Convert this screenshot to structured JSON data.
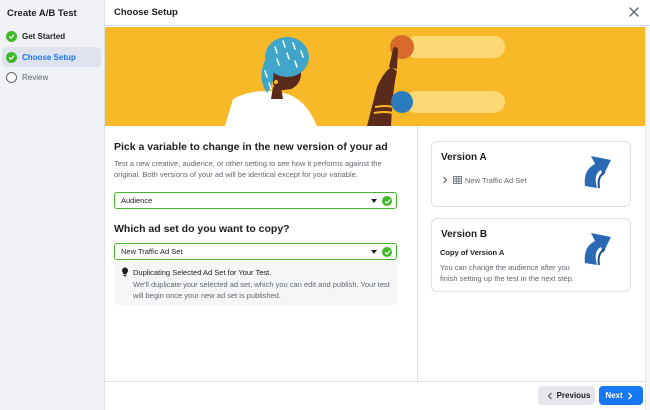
{
  "sidebar": {
    "title": "Create A/B Test",
    "steps": [
      {
        "label": "Get Started",
        "state": "done"
      },
      {
        "label": "Choose Setup",
        "state": "active"
      },
      {
        "label": "Review",
        "state": "pending"
      }
    ]
  },
  "header": {
    "title": "Choose Setup"
  },
  "main": {
    "variable_title": "Pick a variable to change in the new version of your ad",
    "variable_desc": "Test a new creative, audience, or other setting to see how it performs against the original. Both versions of your ad will be identical except for your variable.",
    "variable_select": "Audience",
    "copy_title": "Which ad set do you want to copy?",
    "copy_select": "New Traffic Ad Set",
    "notice_title": "Duplicating Selected Ad Set for Your Test.",
    "notice_body": "We'll duplicate your selected ad set, which you can edit and publish. Your test will begin once your new ad set is published."
  },
  "versions": {
    "a": {
      "title": "Version A",
      "adset": "New Traffic Ad Set"
    },
    "b": {
      "title": "Version B",
      "subtitle": "Copy of Version A",
      "desc": "You can change the audience after you finish setting up the test in the next step."
    }
  },
  "footer": {
    "previous": "Previous",
    "next": "Next"
  },
  "icons": {
    "step_done": "check-circle-icon",
    "step_pending": "empty-circle-icon",
    "close": "close-icon",
    "select_valid": "check-circle-icon",
    "notice": "lightbulb-icon",
    "version_arrow": "curved-arrow-icon",
    "expand": "chevron-right-icon",
    "adset": "grid-icon",
    "previous": "chevron-left-icon",
    "next": "chevron-right-icon"
  },
  "colors": {
    "accent": "#1877f2",
    "success": "#42b72a",
    "banner": "#f7b928",
    "banner_bubble": "#d86a2b",
    "banner_dot": "#2a7bc0"
  }
}
